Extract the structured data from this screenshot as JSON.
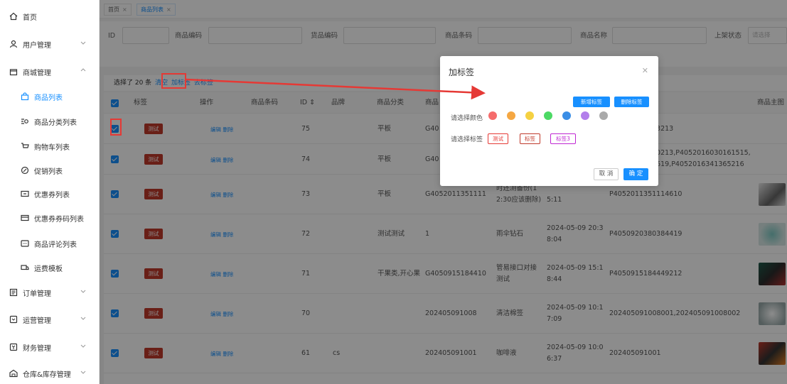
{
  "sidebar": {
    "items": [
      {
        "label": "首页",
        "icon": "home-icon"
      },
      {
        "label": "用户管理",
        "icon": "user-icon"
      },
      {
        "label": "商城管理",
        "icon": "shop-icon"
      },
      {
        "label": "商品列表",
        "icon": "bag-icon"
      },
      {
        "label": "商品分类列表",
        "icon": "category-icon"
      },
      {
        "label": "购物车列表",
        "icon": "cart-icon"
      },
      {
        "label": "促销列表",
        "icon": "promo-icon"
      },
      {
        "label": "优惠券列表",
        "icon": "coupon-icon"
      },
      {
        "label": "优惠券券码列表",
        "icon": "coupon-code-icon"
      },
      {
        "label": "商品评论列表",
        "icon": "comment-icon"
      },
      {
        "label": "运费模板",
        "icon": "shipping-icon"
      },
      {
        "label": "订单管理",
        "icon": "order-icon"
      },
      {
        "label": "运营管理",
        "icon": "operation-icon"
      },
      {
        "label": "财务管理",
        "icon": "finance-icon"
      },
      {
        "label": "仓库&库存管理",
        "icon": "warehouse-icon"
      }
    ]
  },
  "tabs": [
    {
      "label": "首页"
    },
    {
      "label": "商品列表"
    }
  ],
  "filters": {
    "id": "ID",
    "code": "商品编码",
    "goods_code": "货品编码",
    "barcode": "商品条码",
    "name": "商品名称",
    "status": "上架状态",
    "status_placeholder": "请选择"
  },
  "toolbar": {
    "selected": "选择了 20 条",
    "clear": "清空",
    "add_tag": "加标签",
    "remove_tag": "去标签"
  },
  "table": {
    "headers": [
      "标签",
      "操作",
      "商品条码",
      "ID ⇕",
      "品牌",
      "商品分类",
      "商品",
      "商品主图"
    ],
    "op_text": "编辑 删除",
    "tag_text": "测试",
    "rows": [
      {
        "id": "75",
        "brand": "",
        "category": "平板",
        "code": "G40",
        "name": "",
        "time": "",
        "sku": "73213"
      },
      {
        "id": "74",
        "brand": "",
        "category": "平板",
        "code": "G40",
        "name": "",
        "time": "",
        "sku": "80213,P4052016030161515,",
        "sku2": "8619,P4052016341365216"
      },
      {
        "id": "73",
        "brand": "",
        "category": "平板",
        "code": "G4052011351111",
        "name": "时还测备份(1",
        "name2": "2:30应该删除)",
        "time": "",
        "time2": "5:11",
        "sku": "P4052011351114610"
      },
      {
        "id": "72",
        "brand": "",
        "category": "测试测试",
        "code": "1",
        "name": "雨伞钻石",
        "time": "2024-05-09 20:3",
        "time2": "8:04",
        "sku": "P4050920380384419"
      },
      {
        "id": "71",
        "brand": "",
        "category": "干果类,开心果",
        "code": "G4050915184410",
        "name": "管易接口对接",
        "name2": "测试",
        "time": "2024-05-09 15:1",
        "time2": "8:44",
        "sku": "P4050915184449212"
      },
      {
        "id": "70",
        "brand": "",
        "category": "",
        "code": "202405091008",
        "name": "清洁棉签",
        "time": "2024-05-09 10:1",
        "time2": "7:09",
        "sku": "202405091008001,202405091008002"
      },
      {
        "id": "61",
        "brand": "cs",
        "category": "",
        "code": "202405091001",
        "name": "咖啡液",
        "time": "2024-05-09 10:0",
        "time2": "6:37",
        "sku": "202405091001"
      }
    ]
  },
  "modal": {
    "title": "加标签",
    "add_tag_btn": "新增标签",
    "delete_tag_btn": "删除标签",
    "color_label": "请选择颜色",
    "tag_label": "请选择标签",
    "colors": [
      "#f56c6c",
      "#f5a742",
      "#f5d142",
      "#4cd964",
      "#3a8ee6",
      "#b37feb",
      "#aaaaaa"
    ],
    "tags": [
      {
        "label": "测试",
        "color": "#e53935"
      },
      {
        "label": "标签",
        "color": "#c0392b"
      },
      {
        "label": "标签3",
        "color": "#c026d3"
      }
    ],
    "cancel": "取 消",
    "confirm": "确 定"
  }
}
